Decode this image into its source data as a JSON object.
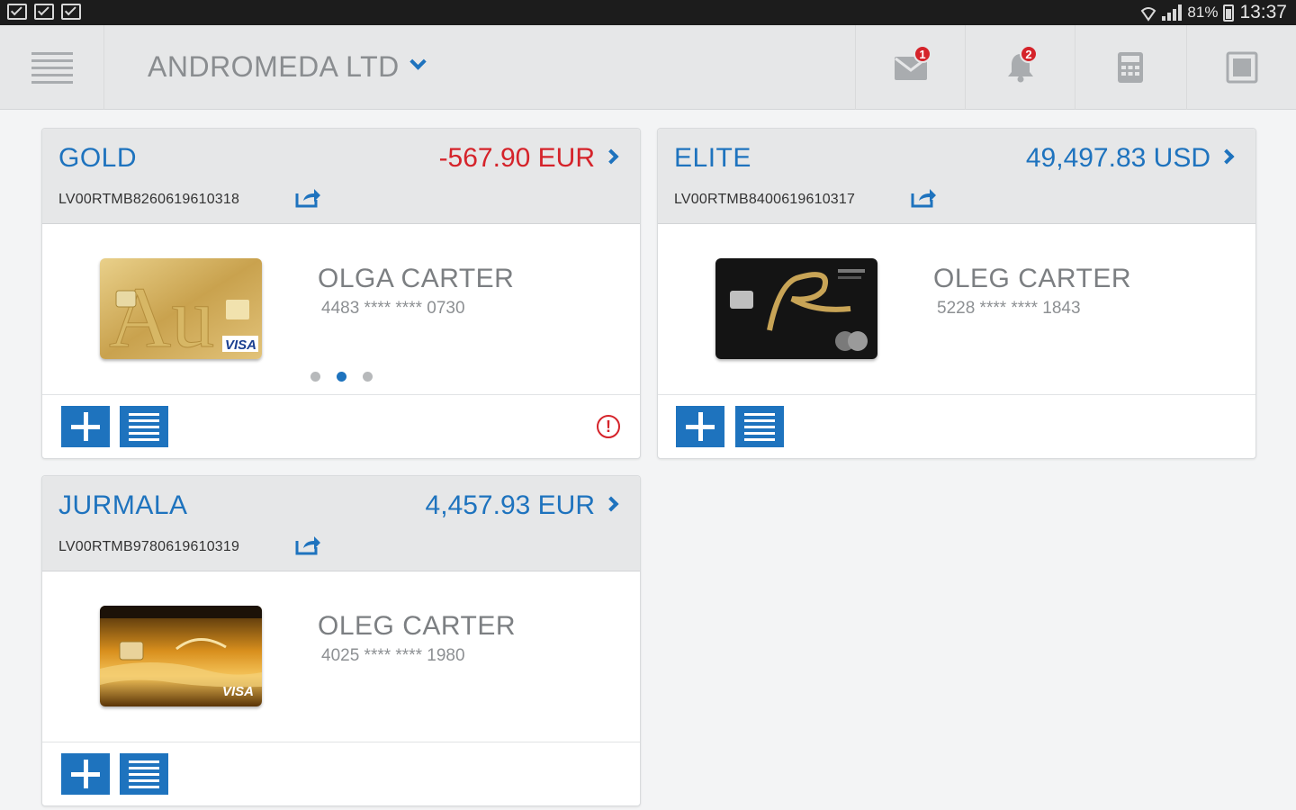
{
  "status_bar": {
    "battery": "81%",
    "time": "13:37",
    "left_icons": [
      "gmail-icon",
      "photos-icon",
      "photos-icon"
    ]
  },
  "header": {
    "company": "ANDROMEDA LTD",
    "messages_badge": "1",
    "notifications_badge": "2",
    "icons": [
      "menu-icon",
      "chevron-down-icon",
      "envelope-icon",
      "bell-icon",
      "calculator-icon",
      "tablet-icon"
    ]
  },
  "accounts": [
    {
      "name": "GOLD",
      "balance": "-567.90 EUR",
      "iban": "LV00RTMB8260619610318",
      "holder": "OLGA CARTER",
      "card_number": "4483 **** **** 0730",
      "card_style": "gold",
      "card_brand": "VISA"
    },
    {
      "name": "ELITE",
      "balance": "49,497.83 USD",
      "iban": "LV00RTMB8400619610317",
      "holder": "OLEG CARTER",
      "card_number": "5228 **** **** 1843",
      "card_style": "black"
    },
    {
      "name": "JURMALA",
      "balance": "4,457.93 EUR",
      "iban": "LV00RTMB9780619610319",
      "holder": "OLEG CARTER",
      "card_number": "4025 **** **** 1980",
      "card_style": "jurmala",
      "card_brand": "VISA"
    }
  ],
  "colors": {
    "accent": "#1e73be",
    "negative": "#d5232a",
    "header_bg": "#e6e7e8",
    "page_bg": "#f3f4f5"
  }
}
